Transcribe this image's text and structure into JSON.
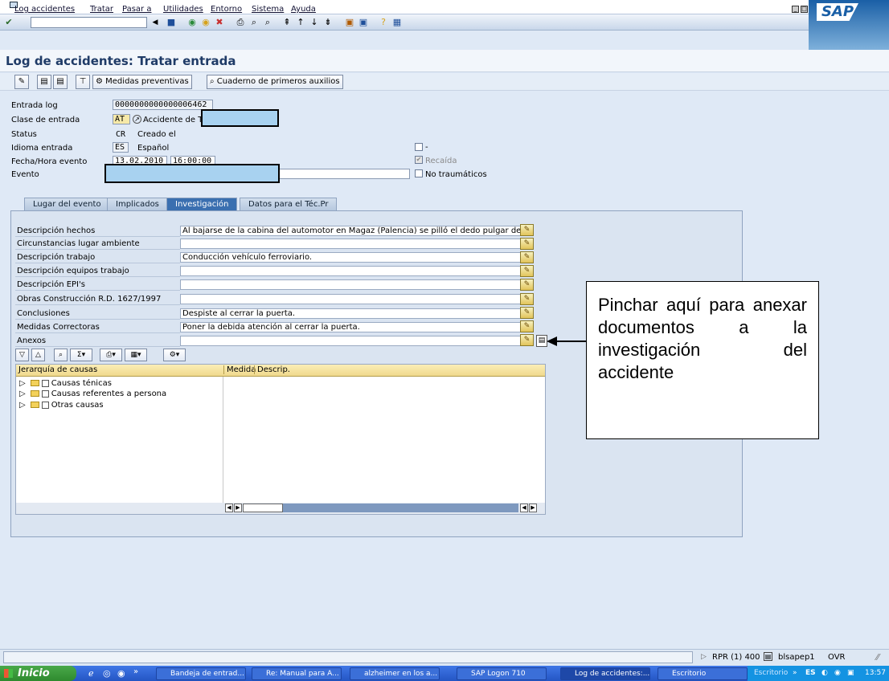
{
  "menu": [
    "Log accidentes",
    "Tratar",
    "Pasar a",
    "Utilidades",
    "Entorno",
    "Sistema",
    "Ayuda"
  ],
  "sap_logo": "SAP",
  "title": "Log de accidentes: Tratar entrada",
  "app_toolbar": {
    "medidas": "Medidas preventivas",
    "cuaderno": "Cuaderno de primeros auxilios"
  },
  "header": {
    "entrada_log_label": "Entrada log",
    "entrada_log": "0000000000000006462",
    "clase_label": "Clase de entrada",
    "clase_code": "AT",
    "clase_text": "Accidente de T",
    "status_label": "Status",
    "status_code": "CR",
    "status_text": "Creado el",
    "idioma_label": "Idioma entrada",
    "idioma_code": "ES",
    "idioma_text": "Español",
    "fecha_label": "Fecha/Hora evento",
    "fecha": "13.02.2010",
    "hora": "16:00:00",
    "evento_label": "Evento",
    "dash": "-",
    "recaida": "Recaída",
    "no_traumaticos": "No traumáticos"
  },
  "tabs": [
    "Lugar del evento",
    "Implicados",
    "Investigación",
    "Datos para el Téc.Pr"
  ],
  "investigacion": [
    {
      "label": "Descripción hechos",
      "value": "Al bajarse de la cabina del automotor en Magaz (Palencia) se pilló el dedo pulgar de la m"
    },
    {
      "label": "Circunstancias lugar ambiente",
      "value": ""
    },
    {
      "label": "Descripción trabajo",
      "value": "Conducción vehículo ferroviario."
    },
    {
      "label": "Descripción equipos trabajo",
      "value": ""
    },
    {
      "label": "Descripción EPI's",
      "value": ""
    },
    {
      "label": "Obras Construcción R.D. 1627/1997",
      "value": ""
    },
    {
      "label": "Conclusiones",
      "value": "Despiste al cerrar la puerta."
    },
    {
      "label": "Medidas Correctoras",
      "value": "Poner la debida atención al cerrar la puerta."
    },
    {
      "label": "Anexos",
      "value": ""
    }
  ],
  "tree": {
    "headers": [
      "Jerarquía de causas",
      "Medida",
      "Descrip."
    ],
    "items": [
      "Causas ténicas",
      "Causas referentes a persona",
      "Otras causas"
    ]
  },
  "callout": "Pinchar aquí para anexar documentos a la investigación del accidente",
  "status": {
    "sys": "RPR (1) 400",
    "server": "blsapep1",
    "mode": "OVR"
  },
  "taskbar": {
    "start": "Inicio",
    "tasks": [
      "Bandeja de entrad...",
      "Re: Manual para A...",
      "alzheimer en los a...",
      "SAP Logon 710",
      "Log de accidentes:...",
      "Escritorio"
    ],
    "tray_label": "Escritorio",
    "lang": "ES",
    "time": "13:57"
  }
}
